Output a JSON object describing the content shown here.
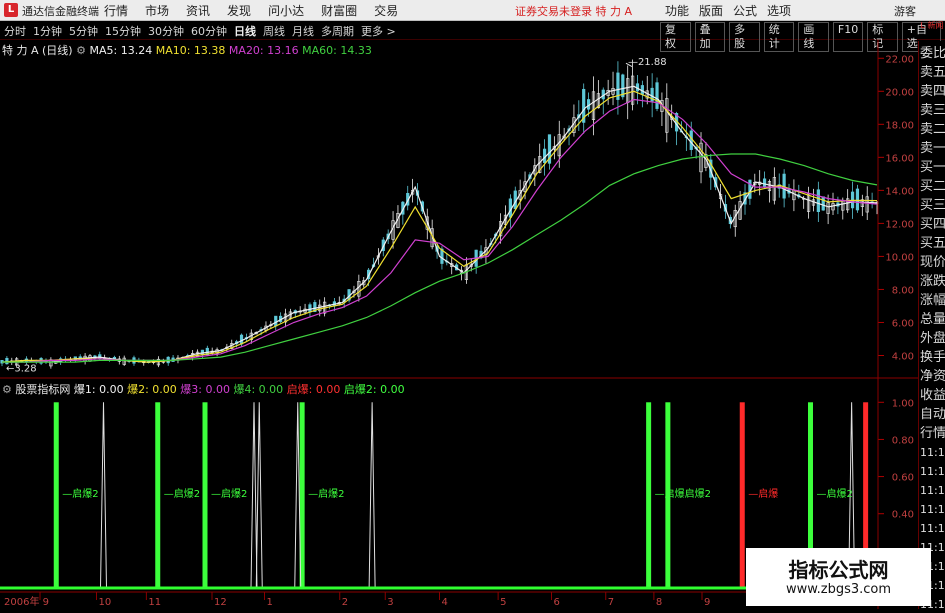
{
  "titlebar": {
    "app_name": "通达信金融终端",
    "menu": [
      "行情",
      "市场",
      "资讯",
      "发现",
      "问小达",
      "财富圈",
      "交易"
    ],
    "notice": "证券交易未登录  特 力 A",
    "right_menu": [
      "功能",
      "版面",
      "公式",
      "选项"
    ],
    "user": "游客"
  },
  "toolbar": {
    "periods": [
      "分时",
      "1分钟",
      "5分钟",
      "15分钟",
      "30分钟",
      "60分钟",
      "日线",
      "周线",
      "月线",
      "多周期",
      "更多 >"
    ],
    "active_period": "日线",
    "tools": [
      "复权",
      "叠加",
      "多股",
      "统计",
      "画线",
      "F10",
      "标记",
      "+自选"
    ]
  },
  "main_chart": {
    "stock_label": "特 力 A (日线)",
    "ma": [
      {
        "label": "MA5: 13.24",
        "color": "#f0f0f0"
      },
      {
        "label": "MA10: 13.38",
        "color": "#f0e030"
      },
      {
        "label": "MA20: 13.16",
        "color": "#d040d0"
      },
      {
        "label": "MA60: 14.33",
        "color": "#40d040"
      }
    ],
    "high_label": "21.88",
    "low_label": "3.28"
  },
  "indicator": {
    "name": "股票指标网",
    "items": [
      {
        "label": "爆1: 0.00",
        "color": "#f0f0f0"
      },
      {
        "label": "爆2: 0.00",
        "color": "#f0e030"
      },
      {
        "label": "爆3: 0.00",
        "color": "#d040d0"
      },
      {
        "label": "爆4: 0.00",
        "color": "#40d040"
      },
      {
        "label": "启爆: 0.00",
        "color": "#ff3030"
      },
      {
        "label": "启爆2: 0.00",
        "color": "#40ff40"
      }
    ],
    "bar_labels": [
      "启爆2",
      "启爆2",
      "启爆2",
      "启爆2",
      "启爆启爆2",
      "启爆",
      "启爆2"
    ]
  },
  "side_panel": {
    "items": [
      "委比",
      "卖五",
      "卖四",
      "卖三",
      "卖二",
      "卖一",
      "买一",
      "买二",
      "买三",
      "买四",
      "买五",
      "现价",
      "涨跌",
      "涨幅",
      "总量",
      "外盘",
      "换手",
      "净资",
      "收益",
      "自动",
      "行情",
      "11:1",
      "11:1",
      "11:1",
      "11:1",
      "11:1",
      "11:1",
      "11:1",
      "11:1",
      "11:1"
    ],
    "badge": "L 新闻"
  },
  "watermark": {
    "title": "指标公式网",
    "url": "www.zbgs3.com"
  },
  "chart_data": [
    {
      "type": "line",
      "title": "",
      "xlabel": "",
      "ylabel": "",
      "ylim": [
        3.0,
        22.5
      ],
      "yticks": [
        "22.00",
        "20.00",
        "18.00",
        "16.00",
        "14.00",
        "12.00",
        "10.00",
        "8.00",
        "6.00",
        "4.00"
      ],
      "x_date_labels": [
        "2006年 9",
        "10",
        "11",
        "12",
        "1",
        "2",
        "3",
        "4",
        "5",
        "6",
        "7",
        "8",
        "9",
        "10"
      ],
      "series": [
        {
          "name": "MA5",
          "color": "#f0f0f0",
          "values": [
            3.6,
            3.7,
            3.6,
            3.8,
            3.9,
            3.7,
            3.6,
            3.7,
            4.1,
            4.3,
            5.0,
            5.8,
            6.6,
            6.9,
            7.2,
            8.6,
            11.5,
            14.2,
            10.0,
            9.0,
            10.5,
            13.0,
            15.5,
            17.0,
            19.0,
            20.0,
            20.3,
            19.5,
            17.5,
            15.8,
            12.0,
            14.5,
            14.2,
            13.5,
            13.0,
            13.3,
            13.24
          ]
        },
        {
          "name": "MA10",
          "color": "#f0e030",
          "values": [
            3.6,
            3.7,
            3.7,
            3.8,
            3.8,
            3.7,
            3.6,
            3.7,
            4.0,
            4.2,
            4.8,
            5.6,
            6.3,
            6.8,
            7.1,
            8.2,
            10.5,
            13.0,
            10.5,
            9.4,
            10.2,
            12.5,
            15.0,
            16.8,
            18.5,
            19.6,
            20.0,
            19.4,
            17.8,
            16.0,
            13.5,
            14.0,
            14.3,
            13.8,
            13.3,
            13.4,
            13.38
          ]
        },
        {
          "name": "MA20",
          "color": "#d040d0",
          "values": [
            3.6,
            3.6,
            3.7,
            3.7,
            3.8,
            3.7,
            3.7,
            3.7,
            3.9,
            4.1,
            4.6,
            5.3,
            6.0,
            6.5,
            6.9,
            7.6,
            9.0,
            11.0,
            10.8,
            9.8,
            10.0,
            11.8,
            14.0,
            16.0,
            17.6,
            18.8,
            19.5,
            19.3,
            18.3,
            16.8,
            15.0,
            14.2,
            14.2,
            13.9,
            13.5,
            13.3,
            13.16
          ]
        },
        {
          "name": "MA60",
          "color": "#40d040",
          "values": [
            3.6,
            3.6,
            3.6,
            3.6,
            3.7,
            3.7,
            3.7,
            3.7,
            3.8,
            3.9,
            4.2,
            4.6,
            5.0,
            5.4,
            5.8,
            6.3,
            7.0,
            7.8,
            8.5,
            9.0,
            9.6,
            10.4,
            11.3,
            12.2,
            13.2,
            14.3,
            15.0,
            15.5,
            15.9,
            16.1,
            16.2,
            16.2,
            15.9,
            15.5,
            15.0,
            14.6,
            14.33
          ]
        }
      ]
    },
    {
      "type": "bar",
      "title": "",
      "ylim": [
        0,
        1.05
      ],
      "yticks": [
        "1.00",
        "0.80",
        "0.60",
        "0.40",
        "0.20"
      ],
      "series": [
        {
          "name": "启爆2",
          "color": "#3cff3c",
          "positions": [
            0.062,
            0.178,
            0.232,
            0.343,
            0.739,
            0.761,
            0.924
          ],
          "values": [
            1,
            1,
            1,
            1,
            1,
            1,
            1
          ]
        },
        {
          "name": "启爆",
          "color": "#ff2a2a",
          "positions": [
            0.846,
            0.987
          ],
          "values": [
            1,
            1
          ]
        },
        {
          "name": "爆1",
          "color": "#e0e0e0",
          "positions": [
            0.116,
            0.288,
            0.294,
            0.338,
            0.423,
            0.971
          ],
          "values": [
            1,
            1,
            1,
            1,
            1,
            1
          ]
        }
      ]
    }
  ]
}
